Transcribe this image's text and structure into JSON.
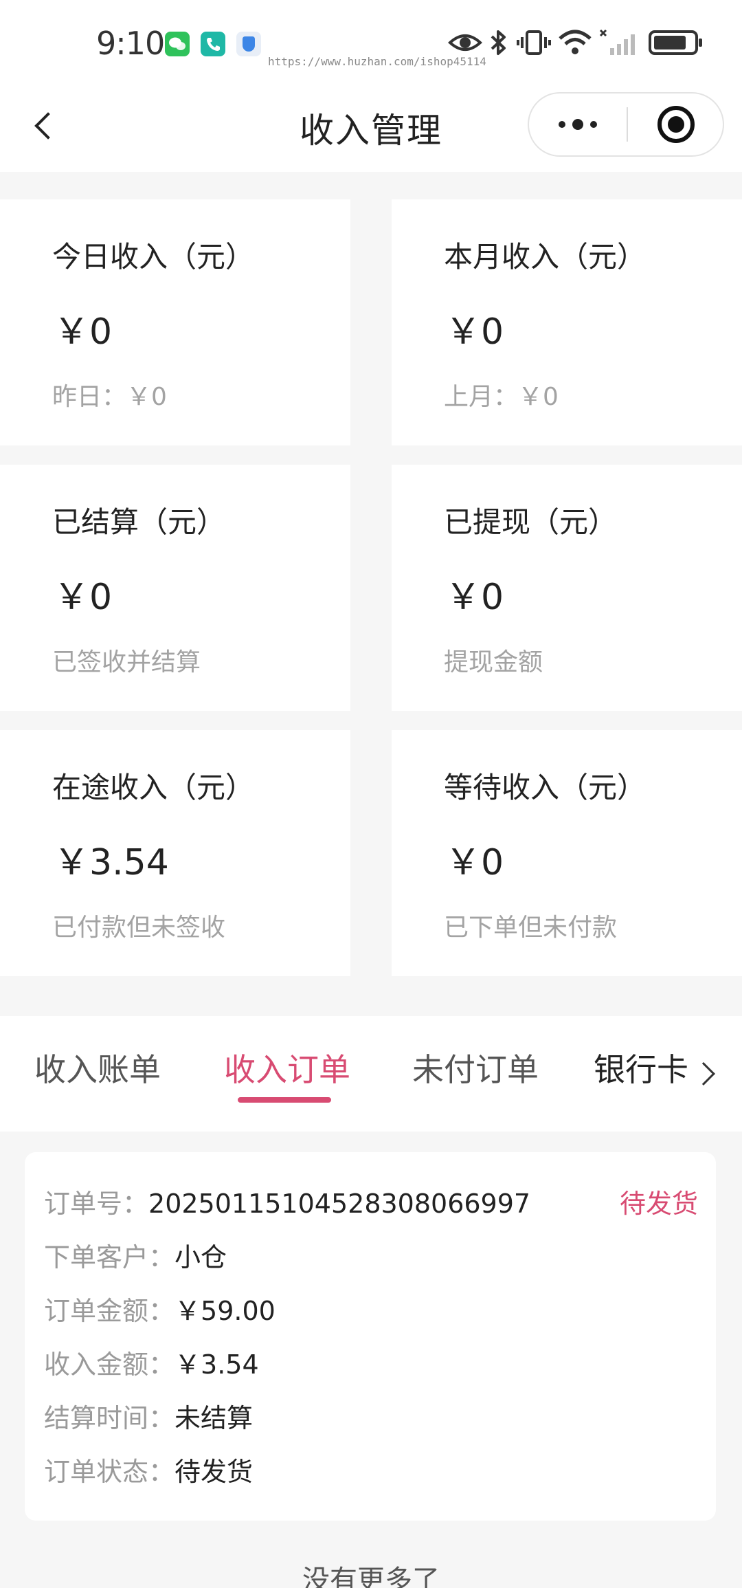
{
  "status_bar": {
    "time": "9:10",
    "watermark": "https://www.huzhan.com/ishop45114",
    "icons": [
      "wechat-icon",
      "phone-icon",
      "shield-icon",
      "eye-icon",
      "bluetooth-icon",
      "vibrate-icon",
      "wifi-icon",
      "signal-icon",
      "battery-icon"
    ]
  },
  "nav": {
    "title": "收入管理",
    "icons": [
      "back-icon",
      "more-icon",
      "target-icon"
    ]
  },
  "stats": [
    {
      "label": "今日收入（元）",
      "value": "￥0",
      "sub": "昨日：￥0"
    },
    {
      "label": "本月收入（元）",
      "value": "￥0",
      "sub": "上月：￥0"
    },
    {
      "label": "已结算（元）",
      "value": "￥0",
      "sub": "已签收并结算"
    },
    {
      "label": "已提现（元）",
      "value": "￥0",
      "sub": "提现金额"
    },
    {
      "label": "在途收入（元）",
      "value": "￥3.54",
      "sub": "已付款但未签收"
    },
    {
      "label": "等待收入（元）",
      "value": "￥0",
      "sub": "已下单但未付款"
    }
  ],
  "tabs": {
    "items": [
      "收入账单",
      "收入订单",
      "未付订单",
      "银行卡"
    ],
    "active": "收入订单",
    "accent_color": "#d84b72"
  },
  "order": {
    "status": "待发货",
    "rows": [
      {
        "key": "订单号：",
        "value": "20250115104528308066997"
      },
      {
        "key": "下单客户：",
        "value": "小仓"
      },
      {
        "key": "订单金额：",
        "value": "￥59.00"
      },
      {
        "key": "收入金额：",
        "value": "￥3.54"
      },
      {
        "key": "结算时间：",
        "value": "未结算"
      },
      {
        "key": "订单状态：",
        "value": "待发货"
      }
    ]
  },
  "footer": {
    "text": "没有更多了"
  }
}
